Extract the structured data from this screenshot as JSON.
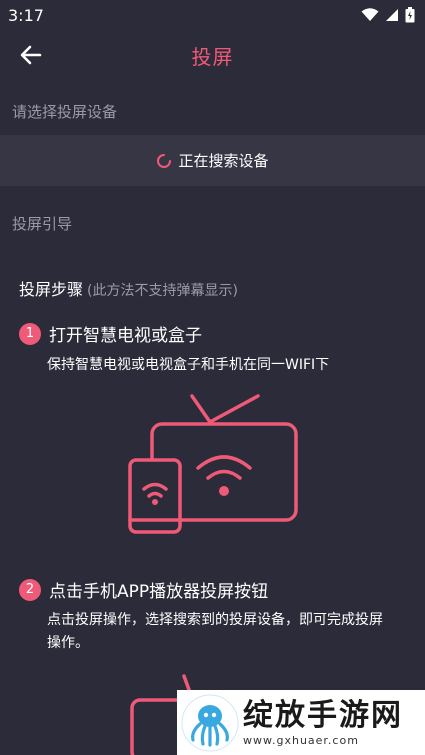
{
  "status_bar": {
    "time": "3:17",
    "icons": [
      "wifi-icon",
      "signal-icon",
      "battery-icon"
    ]
  },
  "app_bar": {
    "title": "投屏",
    "back_icon": "arrow-left-icon"
  },
  "device_section": {
    "label": "请选择投屏设备"
  },
  "search": {
    "status": "正在搜索设备",
    "icon": "loading-spinner-icon"
  },
  "guide_section": {
    "label": "投屏引导"
  },
  "steps_heading": {
    "title": "投屏步骤",
    "note": "(此方法不支持弹幕显示)"
  },
  "steps": [
    {
      "number": "1",
      "title": "打开智慧电视或盒子",
      "description": "保持智慧电视或电视盒子和手机在同一WIFI下",
      "illustration": "tv-phone-wifi-icon"
    },
    {
      "number": "2",
      "title": "点击手机APP播放器投屏按钮",
      "description": "点击投屏操作，选择搜索到的投屏设备，即可完成投屏操作。",
      "illustration": "tv-icon"
    }
  ],
  "watermark": {
    "title": "绽放手游网",
    "url": "www.gxhuaer.com",
    "logo": "octopus-logo"
  },
  "colors": {
    "background": "#2b2b3a",
    "accent": "#ef5a78",
    "row": "#363645",
    "muted": "#9a9aa8"
  }
}
